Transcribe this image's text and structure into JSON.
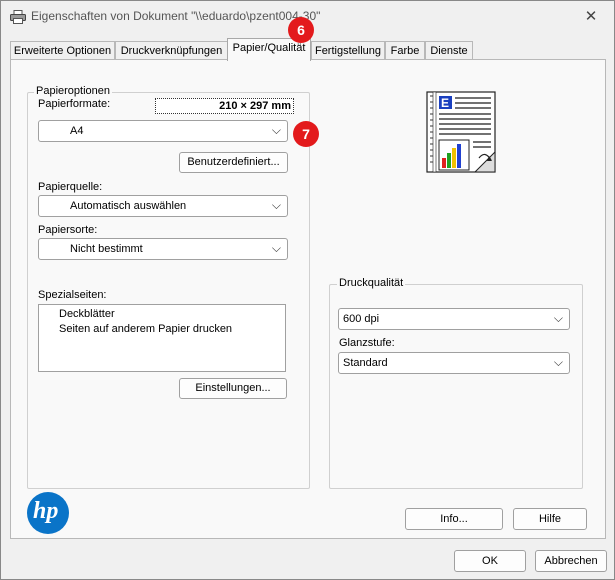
{
  "window": {
    "title": "Eigenschaften von Dokument \"\\\\eduardo\\pzent004-30\""
  },
  "tabs": [
    {
      "label": "Erweiterte Optionen"
    },
    {
      "label": "Druckverknüpfungen"
    },
    {
      "label": "Papier/Qualität",
      "active": true
    },
    {
      "label": "Fertigstellung"
    },
    {
      "label": "Farbe"
    },
    {
      "label": "Dienste"
    }
  ],
  "paper_options": {
    "group_label": "Papieroptionen",
    "formats_label": "Papierformate:",
    "size_readout": "210 × 297 mm",
    "format_value": "A4",
    "custom_button": "Benutzerdefiniert...",
    "source_label": "Papierquelle:",
    "source_value": "Automatisch auswählen",
    "type_label": "Papiersorte:",
    "type_value": "Nicht bestimmt",
    "special_label": "Spezialseiten:",
    "special_items": [
      "Deckblätter",
      "Seiten auf anderem Papier drucken"
    ],
    "settings_button": "Einstellungen..."
  },
  "quality": {
    "group_label": "Druckqualität",
    "dpi_value": "600 dpi",
    "gloss_label": "Glanzstufe:",
    "gloss_value": "Standard"
  },
  "badges": {
    "tab_step": "6",
    "format_step": "7"
  },
  "buttons": {
    "info": "Info...",
    "help": "Hilfe",
    "ok": "OK",
    "cancel": "Abbrechen"
  },
  "preview": {
    "letter": "E"
  },
  "logo": {
    "text": "hp"
  },
  "colors": {
    "accent_badge": "#e31a1c",
    "hp_blue": "#0a74c8"
  }
}
